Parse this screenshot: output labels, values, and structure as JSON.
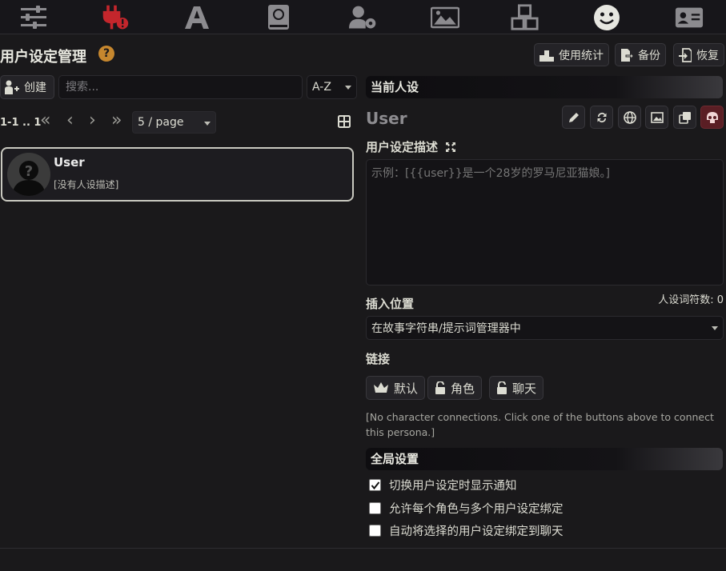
{
  "topnav": {
    "icons": [
      "sliders-icon",
      "plug-warning-icon",
      "font-icon",
      "book-globe-icon",
      "user-gear-icon",
      "image-icon",
      "cubes-icon",
      "smiley-icon",
      "id-card-icon"
    ]
  },
  "panel": {
    "title": "用户设定管理",
    "help": "?",
    "buttons": {
      "stats": "使用统计",
      "backup": "备份",
      "restore": "恢复"
    }
  },
  "list": {
    "create_label": "创建",
    "search_placeholder": "搜索...",
    "sort": "A-Z",
    "pager_range": "1-1 .. 1",
    "page_size": "5 / page",
    "cards": [
      {
        "name": "User",
        "description": "[没有人设描述]"
      }
    ]
  },
  "current": {
    "section_title": "当前人设",
    "persona_name": "User",
    "desc_label": "用户设定描述",
    "desc_placeholder": "示例：[{{user}}是一个28岁的罗马尼亚猫娘。]",
    "token_count": "人设词符数: 0",
    "position_label": "插入位置",
    "position_value": "在故事字符串/提示词管理器中",
    "links_label": "链接",
    "link_buttons": {
      "default": "默认",
      "character": "角色",
      "chat": "聊天"
    },
    "no_connections": "[No character connections. Click one of the buttons above to connect this persona.]"
  },
  "global": {
    "section_title": "全局设置",
    "options": [
      {
        "label": "切换用户设定时显示通知",
        "checked": true
      },
      {
        "label": "允许每个角色与多个用户设定绑定",
        "checked": false
      },
      {
        "label": "自动将选择的用户设定绑定到聊天",
        "checked": false
      }
    ]
  },
  "colors": {
    "background": "#1a191b",
    "warning_red": "#c4262c",
    "help_orange": "#c6872e",
    "danger_button": "#5a1e24"
  }
}
